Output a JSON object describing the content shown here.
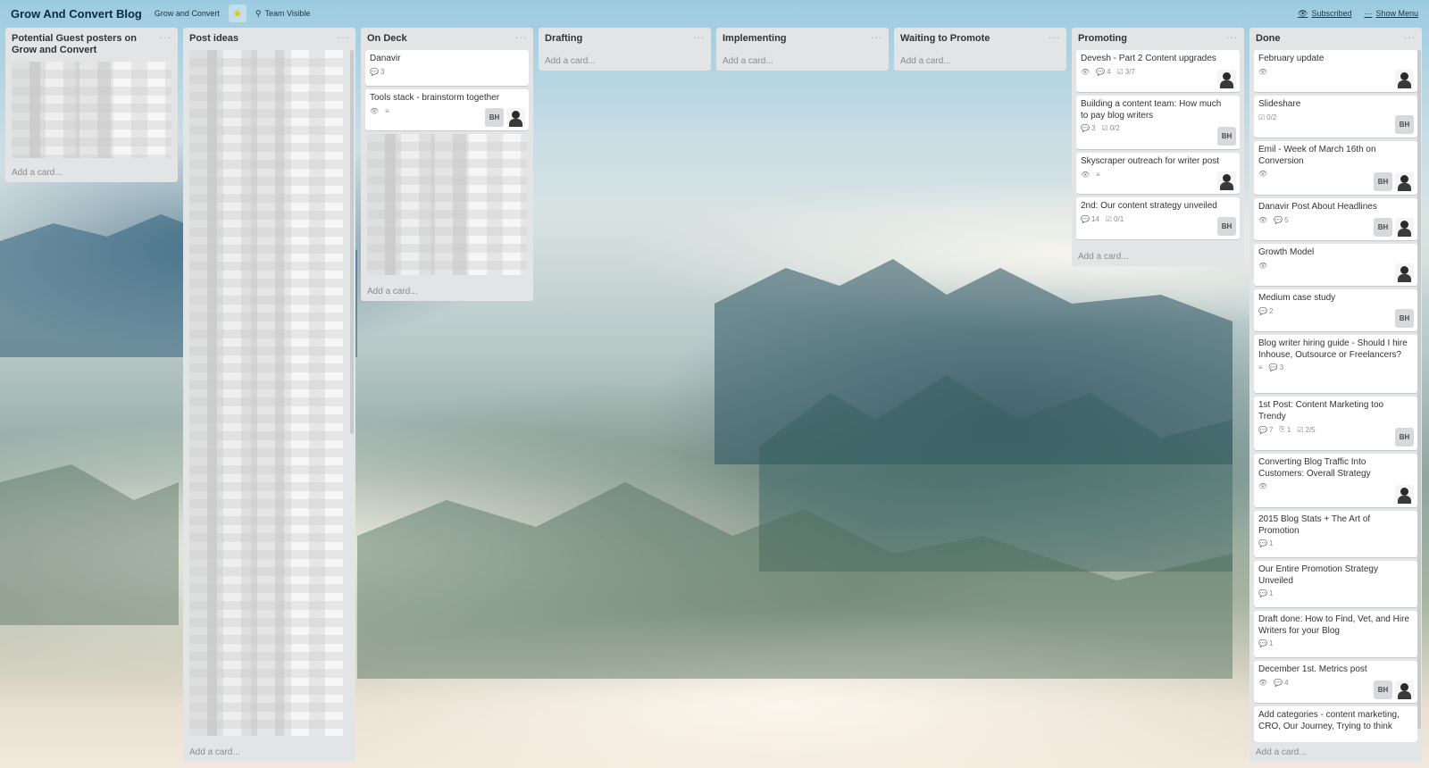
{
  "header": {
    "board_title": "Grow And Convert Blog",
    "org": "Grow and Convert",
    "visibility": "Team Visible",
    "subscribed": "Subscribed",
    "show_menu": "Show Menu"
  },
  "lists": {
    "guest": {
      "title": "Potential Guest posters on Grow and Convert",
      "add": "Add a card..."
    },
    "ideas": {
      "title": "Post ideas",
      "add": "Add a card..."
    },
    "ondeck": {
      "title": "On Deck",
      "add": "Add a card...",
      "cards": [
        {
          "title": "Danavir",
          "comments": "3"
        },
        {
          "title": "Tools stack - brainstorm together",
          "member": "BH"
        }
      ]
    },
    "drafting": {
      "title": "Drafting",
      "add": "Add a card..."
    },
    "implementing": {
      "title": "Implementing",
      "add": "Add a card..."
    },
    "waiting": {
      "title": "Waiting to Promote",
      "add": "Add a card..."
    },
    "promoting": {
      "title": "Promoting",
      "add": "Add a card...",
      "cards": [
        {
          "title": "Devesh - Part 2 Content upgrades",
          "comments": "4",
          "checklist": "3/7"
        },
        {
          "title": "Building a content team: How much to pay blog writers",
          "comments": "3",
          "checklist": "0/2",
          "member": "BH"
        },
        {
          "title": "Skyscraper outreach for writer post"
        },
        {
          "title": "2nd: Our content strategy unveiled",
          "comments": "14",
          "checklist": "0/1",
          "member": "BH"
        }
      ]
    },
    "done": {
      "title": "Done",
      "add": "Add a card...",
      "cards": [
        {
          "title": "February update"
        },
        {
          "title": "Slideshare",
          "checklist": "0/2",
          "member": "BH"
        },
        {
          "title": "Emil - Week of March 16th on Conversion",
          "member": "BH"
        },
        {
          "title": "Danavir Post About Headlines",
          "comments": "5",
          "member": "BH"
        },
        {
          "title": "Growth Model"
        },
        {
          "title": "Medium case study",
          "comments": "2",
          "member": "BH"
        },
        {
          "title": "Blog writer hiring guide - Should I hire Inhouse, Outsource or Freelancers?",
          "comments": "3"
        },
        {
          "title": "1st Post: Content Marketing too Trendy",
          "comments": "7",
          "attachments": "1",
          "checklist": "2/5",
          "member": "BH"
        },
        {
          "title": "Converting Blog Traffic Into Customers: Overall Strategy"
        },
        {
          "title": "2015 Blog Stats + The Art of Promotion",
          "comments": "1"
        },
        {
          "title": "Our Entire Promotion Strategy Unveiled",
          "comments": "1"
        },
        {
          "title": "Draft done: How to Find, Vet, and Hire Writers for your Blog",
          "comments": "1"
        },
        {
          "title": "December 1st. Metrics post",
          "comments": "4",
          "member": "BH"
        },
        {
          "title": "Add categories - content marketing, CRO, Our Journey, Trying to think"
        }
      ]
    }
  },
  "icons": {
    "comment": "💬",
    "checklist": "☑",
    "eye": "👁",
    "description": "≡",
    "attachment": "⎘",
    "star": "★",
    "lock": "⚲",
    "menu": "···"
  }
}
